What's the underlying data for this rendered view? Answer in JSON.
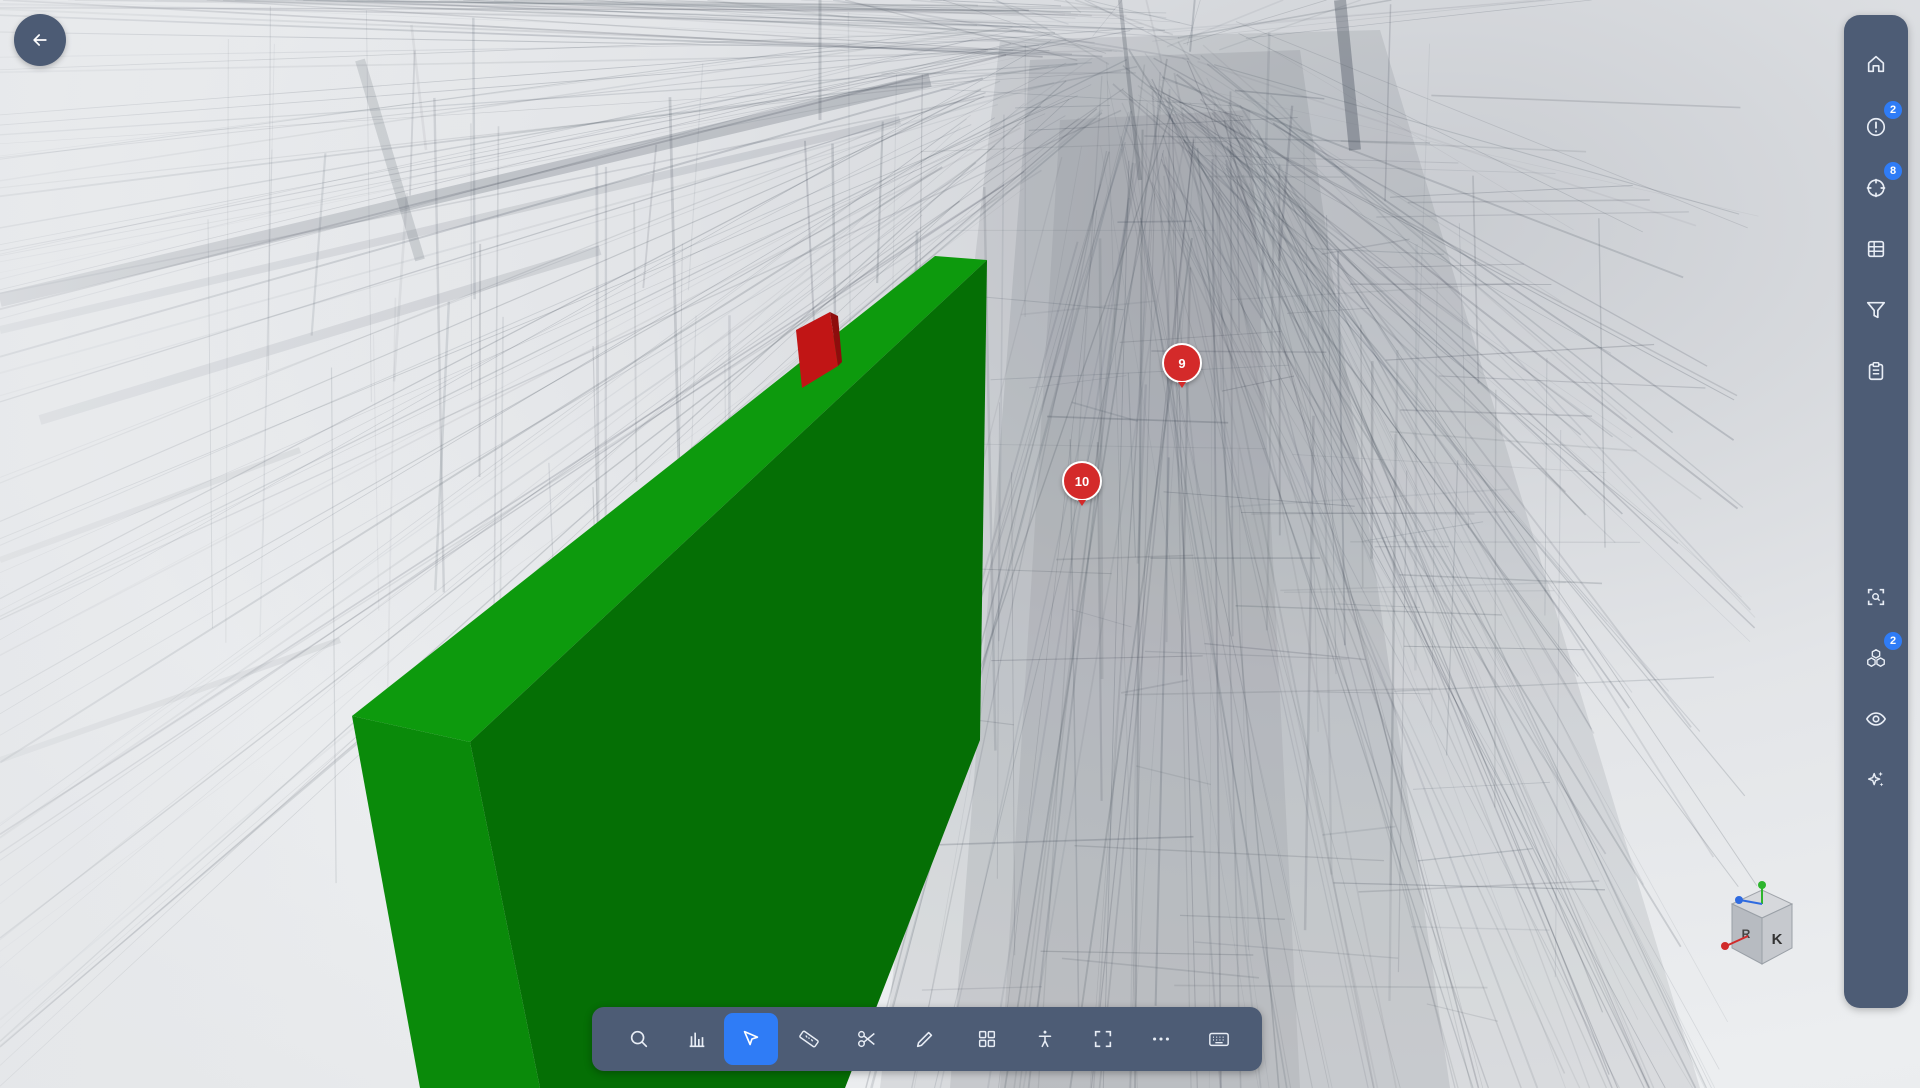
{
  "viewer": {
    "markers": [
      {
        "label": "9"
      },
      {
        "label": "10"
      }
    ],
    "selected_element_color": "#079307",
    "highlight_color": "#c11515"
  },
  "back_button": {
    "icon": "arrow-left-icon"
  },
  "right_sidebar": {
    "items": [
      {
        "name": "home",
        "icon": "home-icon",
        "badge": null
      },
      {
        "name": "issues",
        "icon": "alert-circle-icon",
        "badge": "2"
      },
      {
        "name": "targets",
        "icon": "crosshair-icon",
        "badge": "8"
      },
      {
        "name": "table",
        "icon": "table-icon",
        "badge": null
      },
      {
        "name": "filter",
        "icon": "filter-icon",
        "badge": null
      },
      {
        "name": "clipboard",
        "icon": "clipboard-icon",
        "badge": null
      },
      {
        "name": "focus",
        "icon": "focus-scan-icon",
        "badge": null
      },
      {
        "name": "layers",
        "icon": "object-group-icon",
        "badge": "2"
      },
      {
        "name": "visibility",
        "icon": "eye-icon",
        "badge": null
      },
      {
        "name": "ai",
        "icon": "sparkles-icon",
        "badge": null
      }
    ]
  },
  "toolbar": {
    "active": "select",
    "tools": [
      "search",
      "chart",
      "select",
      "measure",
      "cut",
      "markup",
      "grid",
      "walk",
      "fullscreen",
      "more",
      "keyboard"
    ]
  },
  "nav_cube": {
    "face_labels": [
      "K",
      "R"
    ],
    "axes": [
      "Y",
      "Z",
      "X"
    ]
  },
  "colors": {
    "accent": "#2f7cf6",
    "panel": "#4d5c75",
    "marker": "#d42a2a",
    "badge": "#2f7cf6"
  }
}
